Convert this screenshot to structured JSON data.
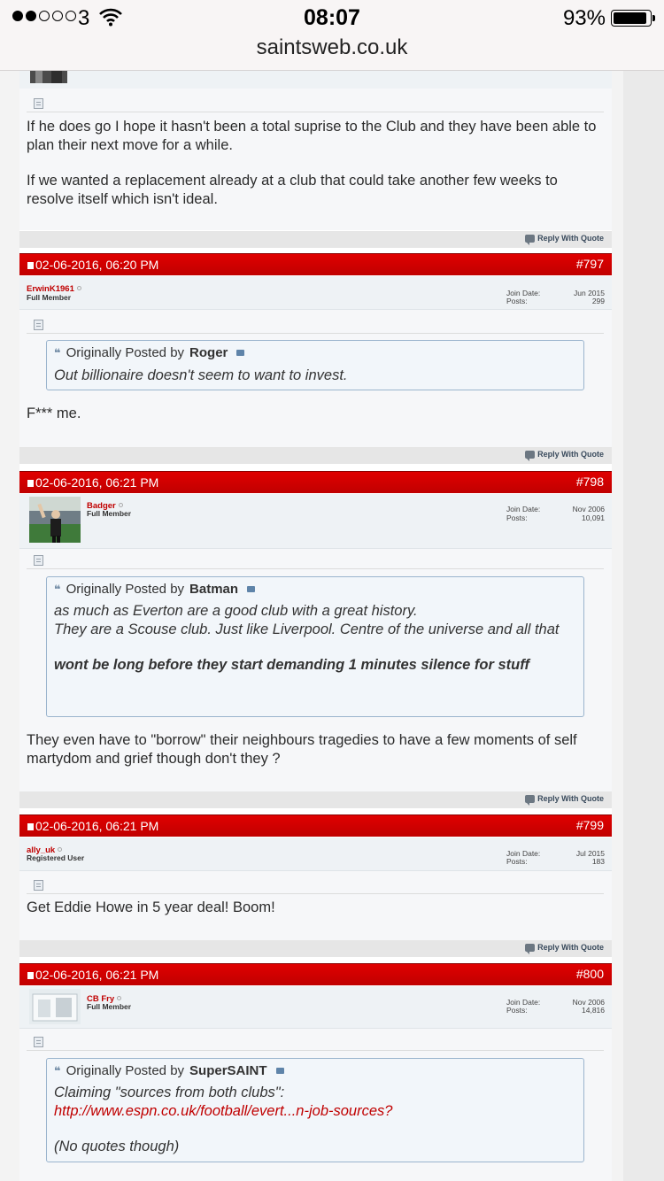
{
  "status": {
    "carrier": "3",
    "time": "08:07",
    "battery": "93%",
    "url": "saintsweb.co.uk",
    "signal_bars_filled": 2,
    "signal_bars_total": 5,
    "battery_level": 0.93
  },
  "reply_label": "Reply With Quote",
  "labels": {
    "join_date": "Join Date:",
    "posts": "Posts:",
    "originally_posted_by": "Originally Posted by"
  },
  "post_prev": {
    "paragraphs": [
      "If he does go I hope it hasn't been a total suprise to the Club and they have been able to plan their next move for a while.",
      "If we wanted a replacement already at a club that could take another few weeks to resolve itself which isn't ideal."
    ]
  },
  "posts": [
    {
      "date": "02-06-2016,   06:20 PM",
      "number": "#797",
      "user": "ErwinK1961",
      "rank": "Full Member",
      "join_date": "Jun 2015",
      "posts": "299",
      "quote": {
        "author": "Roger",
        "lines": [
          "Out billionaire doesn't seem to want to invest."
        ]
      },
      "text": [
        "F*** me."
      ]
    },
    {
      "date": "02-06-2016,   06:21 PM",
      "number": "#798",
      "user": "Badger",
      "rank": "Full Member",
      "join_date": "Nov 2006",
      "posts": "10,091",
      "quote": {
        "author": "Batman",
        "lines": [
          "as much as Everton are a good club with a great history.",
          "They are a Scouse club. Just like Liverpool. Centre of the universe and all that"
        ],
        "bold": "wont be long before they start demanding 1 minutes silence for stuff"
      },
      "text": [
        "They even have to \"borrow\" their neighbours tragedies to have a few moments of self martydom and grief though don't they ?"
      ]
    },
    {
      "date": "02-06-2016,   06:21 PM",
      "number": "#799",
      "user": "ally_uk",
      "rank": "Registered User",
      "join_date": "Jul 2015",
      "posts": "183",
      "text": [
        "Get Eddie Howe in 5 year deal! Boom!"
      ]
    },
    {
      "date": "02-06-2016,   06:21 PM",
      "number": "#800",
      "user": "CB Fry",
      "rank": "Full Member",
      "join_date": "Nov 2006",
      "posts": "14,816",
      "quote": {
        "author": "SuperSAINT",
        "lines": [
          "Claiming \"sources from both clubs\":"
        ],
        "link": "http://www.espn.co.uk/football/evert...n-job-sources?",
        "after": "(No quotes though)"
      }
    }
  ]
}
